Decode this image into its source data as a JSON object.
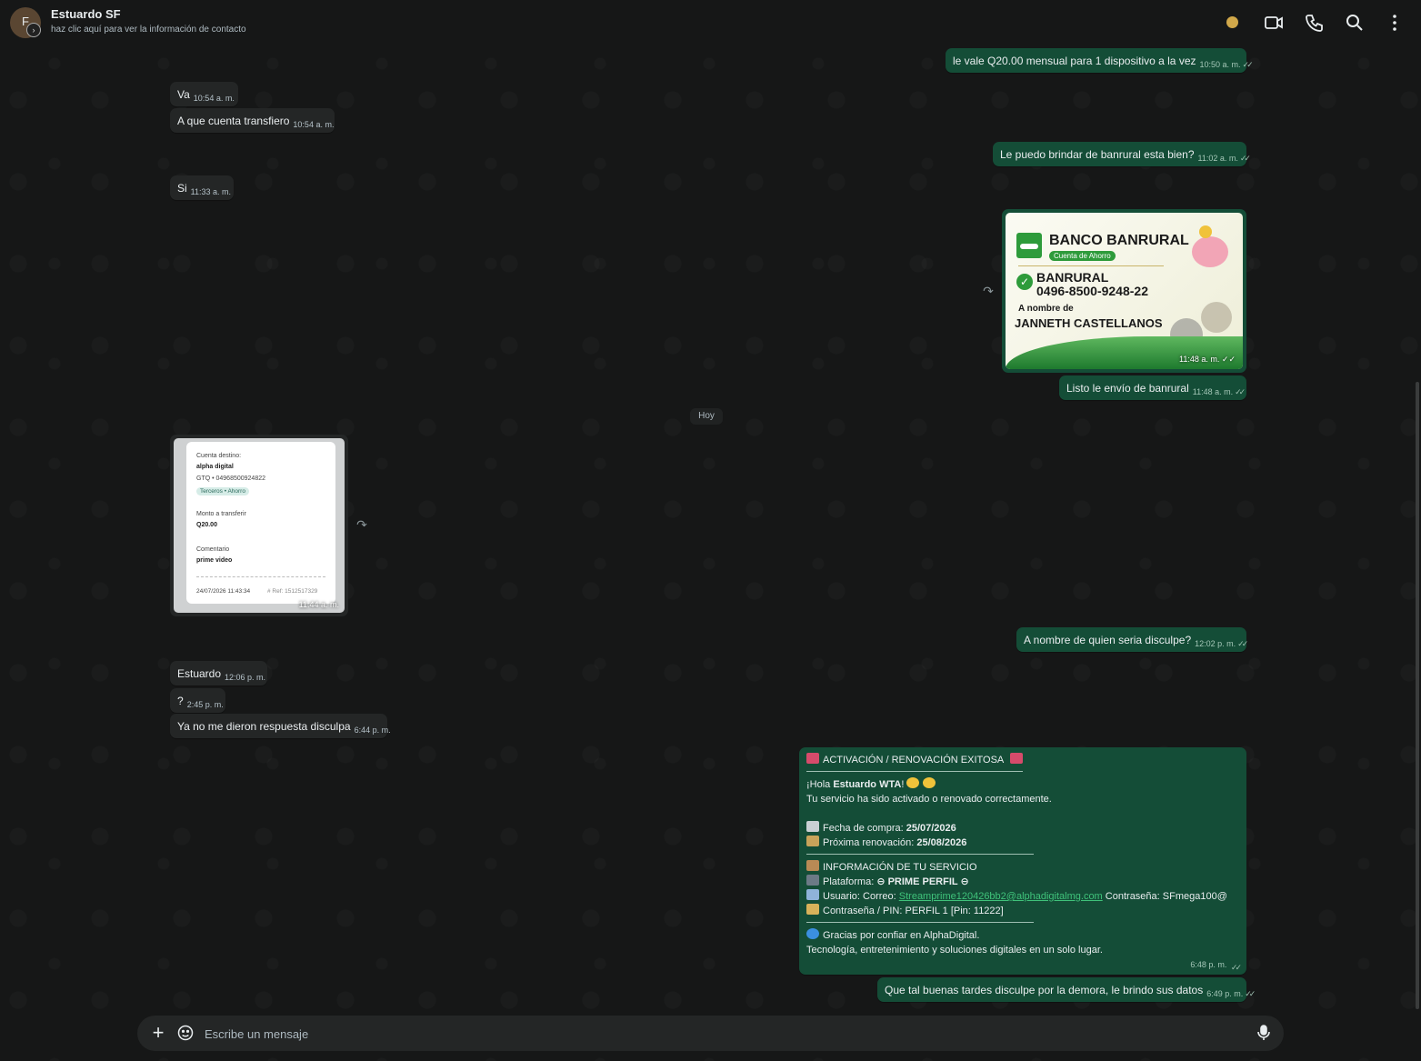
{
  "header": {
    "avatar_letter": "F",
    "contact_name": "Estuardo SF",
    "contact_subtitle": "haz clic aquí para ver la información de contacto"
  },
  "messages": {
    "m1": {
      "text": "le vale Q20.00 mensual para 1 dispositivo a la vez",
      "time": "10:50 a. m."
    },
    "m2": {
      "text": "Va",
      "time": "10:54 a. m."
    },
    "m3": {
      "text": "A que cuenta transfiero",
      "time": "10:54 a. m."
    },
    "m4": {
      "text": "Le puedo brindar de banrural esta bien?",
      "time": "11:02 a. m."
    },
    "m5": {
      "text": "Si",
      "time": "11:33 a. m."
    },
    "m7": {
      "text": "Listo le envío de banrural",
      "time": "11:48 a. m."
    },
    "m9": {
      "text": "A nombre de quien seria disculpe?",
      "time": "12:02 p. m."
    },
    "m10": {
      "text": "Estuardo",
      "time": "12:06 p. m."
    },
    "m11": {
      "text": "?",
      "time": "2:45 p. m."
    },
    "m12": {
      "text": "Ya no me dieron respuesta disculpa",
      "time": "6:44 p. m."
    },
    "m14": {
      "text": "Que tal buenas tardes disculpe por la demora, le brindo sus datos",
      "time": "6:49 p. m."
    }
  },
  "bank_image": {
    "time": "11:48 a. m.",
    "bank_title": "BANCO BANRURAL",
    "account_type": "Cuenta de Ahorro",
    "bank_name": "BANRURAL",
    "account_number": "0496-8500-9248-22",
    "a_nombre_de": "A nombre de",
    "holder": "JANNETH CASTELLANOS"
  },
  "date_divider": "Hoy",
  "receipt_image": {
    "time": "11:44 a. m.",
    "cuenta_destino_label": "Cuenta destino:",
    "cuenta_destino_value": "alpha digital",
    "cuenta_num": "GTQ • 04968500924822",
    "pill": "Terceros • Ahorro",
    "monto_label": "Monto a transferir",
    "monto_value": "Q20.00",
    "comentario_label": "Comentario",
    "comentario_value": "prime video",
    "date": "24/07/2026 11:43:34",
    "ref": "# Ref: 1512517329"
  },
  "activation": {
    "time": "6:48 p. m.",
    "title": "ACTIVACIÓN / RENOVACIÓN EXITOSA",
    "hola_prefix": "¡Hola ",
    "hola_name": "Estuardo WTA",
    "hola_suffix": "!",
    "line_activated": "Tu servicio ha sido activado o renovado correctamente.",
    "fecha_label": "Fecha de compra: ",
    "fecha_value": "25/07/2026",
    "renov_label": "Próxima renovación: ",
    "renov_value": "25/08/2026",
    "info_title": "INFORMACIÓN DE TU SERVICIO",
    "plataforma_label": "Plataforma: ",
    "plataforma_value": "⊖ PRIME PERFIL ⊖",
    "usuario_label": "Usuario: Correo: ",
    "usuario_email": "Streamprime120426bb2@alphadigitalmg.com",
    "usuario_pass": " Contraseña: SFmega100@",
    "pin_line": "Contraseña / PIN: PERFIL 1 [Pin: 11222]",
    "gracias": "Gracias por confiar en AlphaDigital.",
    "tagline": "Tecnología, entretenimiento y soluciones digitales en un solo lugar."
  },
  "composer": {
    "placeholder": "Escribe un mensaje"
  },
  "icons": [
    "video-call-icon",
    "voice-call-icon",
    "search-icon",
    "menu-icon",
    "forward-icon",
    "plus-icon",
    "sticker-icon",
    "mic-icon"
  ],
  "colors": {
    "incoming": "#242626",
    "outgoing": "#144d37",
    "background": "#161717",
    "status_dot": "#d1a84a"
  }
}
